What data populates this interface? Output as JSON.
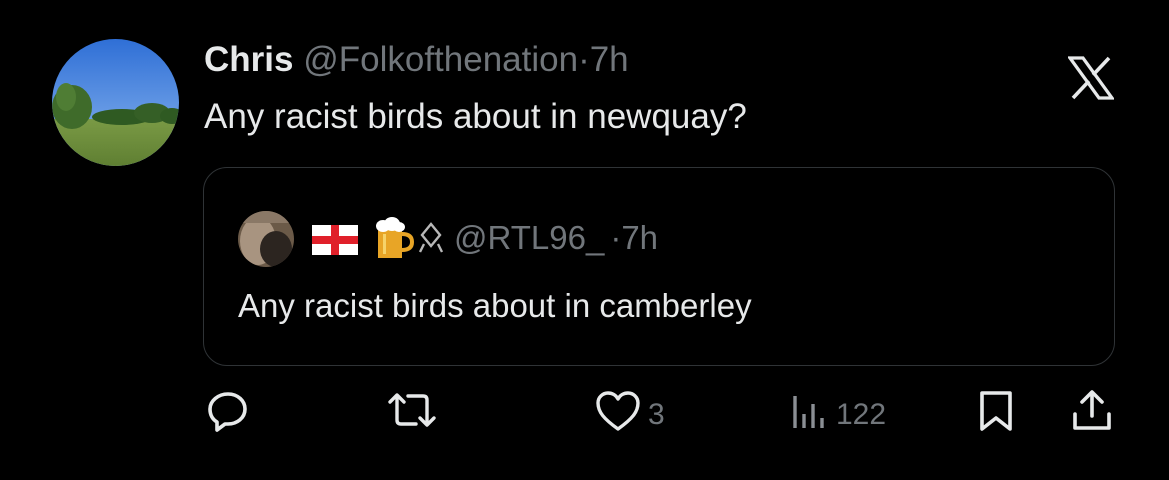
{
  "tweet": {
    "author_name": "Chris",
    "author_handle": "@Folkofthenation",
    "separator": "·",
    "time": "7h",
    "text": "Any racist birds about in newquay?"
  },
  "quoted_tweet": {
    "handle": "@RTL96_",
    "separator": "·",
    "time": "7h",
    "text": "Any racist birds about in camberley"
  },
  "actions": {
    "reply_icon": "reply-icon",
    "retweet_icon": "retweet-icon",
    "like_count": "3",
    "views_count": "122",
    "bookmark_icon": "bookmark-icon",
    "share_icon": "share-icon"
  },
  "colors": {
    "background": "#000000",
    "text_primary": "#e7e9ea",
    "text_secondary": "#71767b",
    "border": "#2f3336"
  }
}
